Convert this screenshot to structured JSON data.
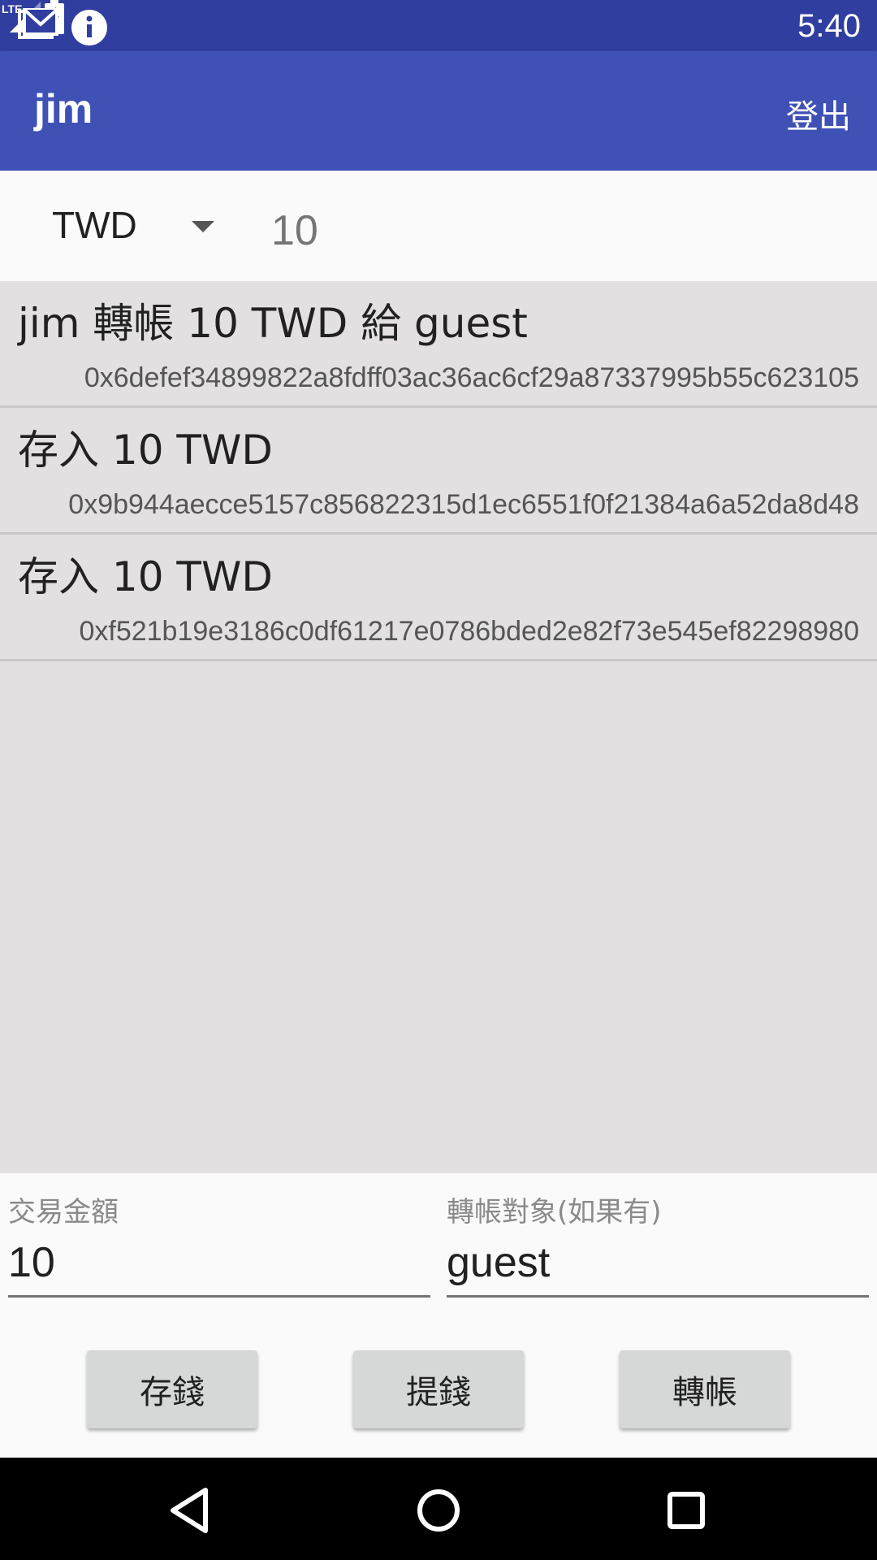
{
  "status_bar": {
    "time": "5:40",
    "network_label": "LTE",
    "icons": [
      "mail-icon",
      "info-icon",
      "signal-icon",
      "battery-charging-icon"
    ]
  },
  "app_bar": {
    "title": "jim",
    "logout_label": "登出"
  },
  "top_row": {
    "currency": "TWD",
    "balance": "10"
  },
  "transactions": [
    {
      "title": "jim 轉帳 10 TWD 給 guest",
      "hash": "0x6defef34899822a8fdff03ac36ac6cf29a87337995b55c623105"
    },
    {
      "title": "存入 10 TWD",
      "hash": "0x9b944aecce5157c856822315d1ec6551f0f21384a6a52da8d48"
    },
    {
      "title": "存入 10 TWD",
      "hash": "0xf521b19e3186c0df61217e0786bded2e82f73e545ef82298980"
    }
  ],
  "form": {
    "amount_label": "交易金額",
    "amount_value": "10",
    "target_label": "轉帳對象(如果有)",
    "target_value": "guest"
  },
  "buttons": {
    "deposit": "存錢",
    "withdraw": "提錢",
    "transfer": "轉帳"
  },
  "nav_bar": {
    "icons": [
      "back-icon",
      "home-icon",
      "recents-icon"
    ]
  },
  "colors": {
    "status_bar": "#303f9f",
    "app_bar": "#3f51b5",
    "list_background": "#e2e0e1",
    "button": "#d6d7d7"
  }
}
